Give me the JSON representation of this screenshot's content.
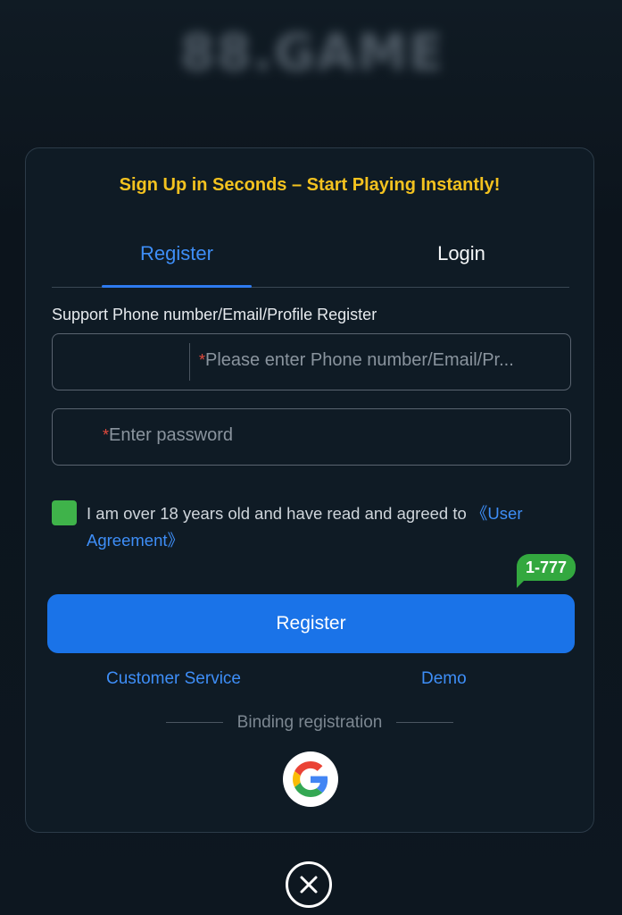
{
  "background": {
    "logo_text": "88.GAME"
  },
  "modal": {
    "headline": "Sign Up in Seconds – Start Playing Instantly!",
    "tabs": [
      {
        "label": "Register",
        "active": true
      },
      {
        "label": "Login",
        "active": false
      }
    ],
    "support_text": "Support Phone number/Email/Profile Register",
    "account_field": {
      "required_mark": "*",
      "placeholder": "Please enter Phone number/Email/Pr..."
    },
    "password_field": {
      "required_mark": "*",
      "placeholder": "Enter password"
    },
    "agreement": {
      "checked": true,
      "text": "I am over 18 years old and have read and agreed to ",
      "link_text": "《User Agreement》"
    },
    "promo_badge": "1-777",
    "register_button": "Register",
    "links": {
      "customer_service": "Customer Service",
      "demo": "Demo"
    },
    "binding_label": "Binding registration",
    "social": [
      {
        "icon": "google-icon"
      }
    ]
  },
  "close_icon": "close-icon",
  "colors": {
    "accent_blue": "#1a73e8",
    "headline_yellow": "#f3c21f",
    "checkbox_green": "#3fb34a",
    "badge_green": "#33a83f",
    "required_red": "#e24a3d"
  }
}
